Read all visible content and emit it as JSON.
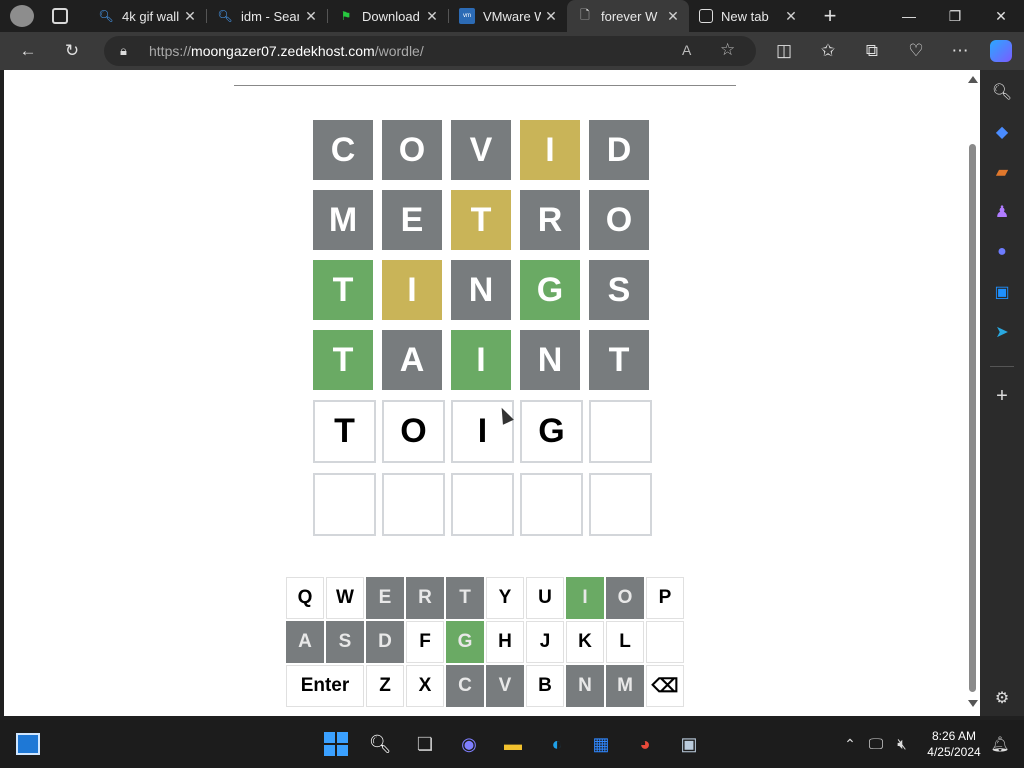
{
  "tabs": [
    {
      "title": "",
      "icon": "profile-icon"
    },
    {
      "title": "",
      "icon": "tab-actions-icon"
    },
    {
      "title": "4k gif wall",
      "icon": "search-icon"
    },
    {
      "title": "idm - Sear",
      "icon": "search-icon"
    },
    {
      "title": "Download",
      "icon": "flag-icon"
    },
    {
      "title": "VMware W",
      "icon": "vmware-icon"
    },
    {
      "title": "forever W",
      "icon": "page-icon"
    },
    {
      "title": "New tab",
      "icon": "newtab-icon"
    }
  ],
  "address": {
    "scheme": "https://",
    "host": "moongazer07.zedekhost.com",
    "path": "/wordle/"
  },
  "board": [
    [
      {
        "l": "C",
        "s": "gray"
      },
      {
        "l": "O",
        "s": "gray"
      },
      {
        "l": "V",
        "s": "gray"
      },
      {
        "l": "I",
        "s": "yellow"
      },
      {
        "l": "D",
        "s": "gray"
      }
    ],
    [
      {
        "l": "M",
        "s": "gray"
      },
      {
        "l": "E",
        "s": "gray"
      },
      {
        "l": "T",
        "s": "yellow"
      },
      {
        "l": "R",
        "s": "gray"
      },
      {
        "l": "O",
        "s": "gray"
      }
    ],
    [
      {
        "l": "T",
        "s": "green"
      },
      {
        "l": "I",
        "s": "yellow"
      },
      {
        "l": "N",
        "s": "gray"
      },
      {
        "l": "G",
        "s": "green"
      },
      {
        "l": "S",
        "s": "gray"
      }
    ],
    [
      {
        "l": "T",
        "s": "green"
      },
      {
        "l": "A",
        "s": "gray"
      },
      {
        "l": "I",
        "s": "green"
      },
      {
        "l": "N",
        "s": "gray"
      },
      {
        "l": "T",
        "s": "gray"
      }
    ],
    [
      {
        "l": "T",
        "s": "empty"
      },
      {
        "l": "O",
        "s": "empty"
      },
      {
        "l": "I",
        "s": "empty"
      },
      {
        "l": "G",
        "s": "empty"
      },
      {
        "l": "",
        "s": "empty"
      }
    ],
    [
      {
        "l": "",
        "s": "empty"
      },
      {
        "l": "",
        "s": "empty"
      },
      {
        "l": "",
        "s": "empty"
      },
      {
        "l": "",
        "s": "empty"
      },
      {
        "l": "",
        "s": "empty"
      }
    ]
  ],
  "keyboard": [
    [
      {
        "k": "Q",
        "s": ""
      },
      {
        "k": "W",
        "s": ""
      },
      {
        "k": "E",
        "s": "gray"
      },
      {
        "k": "R",
        "s": "gray"
      },
      {
        "k": "T",
        "s": "gray"
      },
      {
        "k": "Y",
        "s": ""
      },
      {
        "k": "U",
        "s": ""
      },
      {
        "k": "I",
        "s": "green"
      },
      {
        "k": "O",
        "s": "gray"
      },
      {
        "k": "P",
        "s": ""
      }
    ],
    [
      {
        "k": "A",
        "s": "gray"
      },
      {
        "k": "S",
        "s": "gray"
      },
      {
        "k": "D",
        "s": "gray"
      },
      {
        "k": "F",
        "s": ""
      },
      {
        "k": "G",
        "s": "green"
      },
      {
        "k": "H",
        "s": ""
      },
      {
        "k": "J",
        "s": ""
      },
      {
        "k": "K",
        "s": ""
      },
      {
        "k": "L",
        "s": ""
      },
      {
        "k": "",
        "s": ""
      }
    ],
    [
      {
        "k": "Enter",
        "s": "",
        "wide": true
      },
      {
        "k": "Z",
        "s": ""
      },
      {
        "k": "X",
        "s": ""
      },
      {
        "k": "C",
        "s": "gray"
      },
      {
        "k": "V",
        "s": "gray"
      },
      {
        "k": "B",
        "s": ""
      },
      {
        "k": "N",
        "s": "gray"
      },
      {
        "k": "M",
        "s": "gray"
      },
      {
        "k": "⌫",
        "s": ""
      }
    ]
  ],
  "colors": {
    "green": "#6aaa64",
    "yellow": "#c9b458",
    "gray": "#787c7e"
  },
  "clock": {
    "time": "8:26 AM",
    "date": "4/25/2024"
  }
}
